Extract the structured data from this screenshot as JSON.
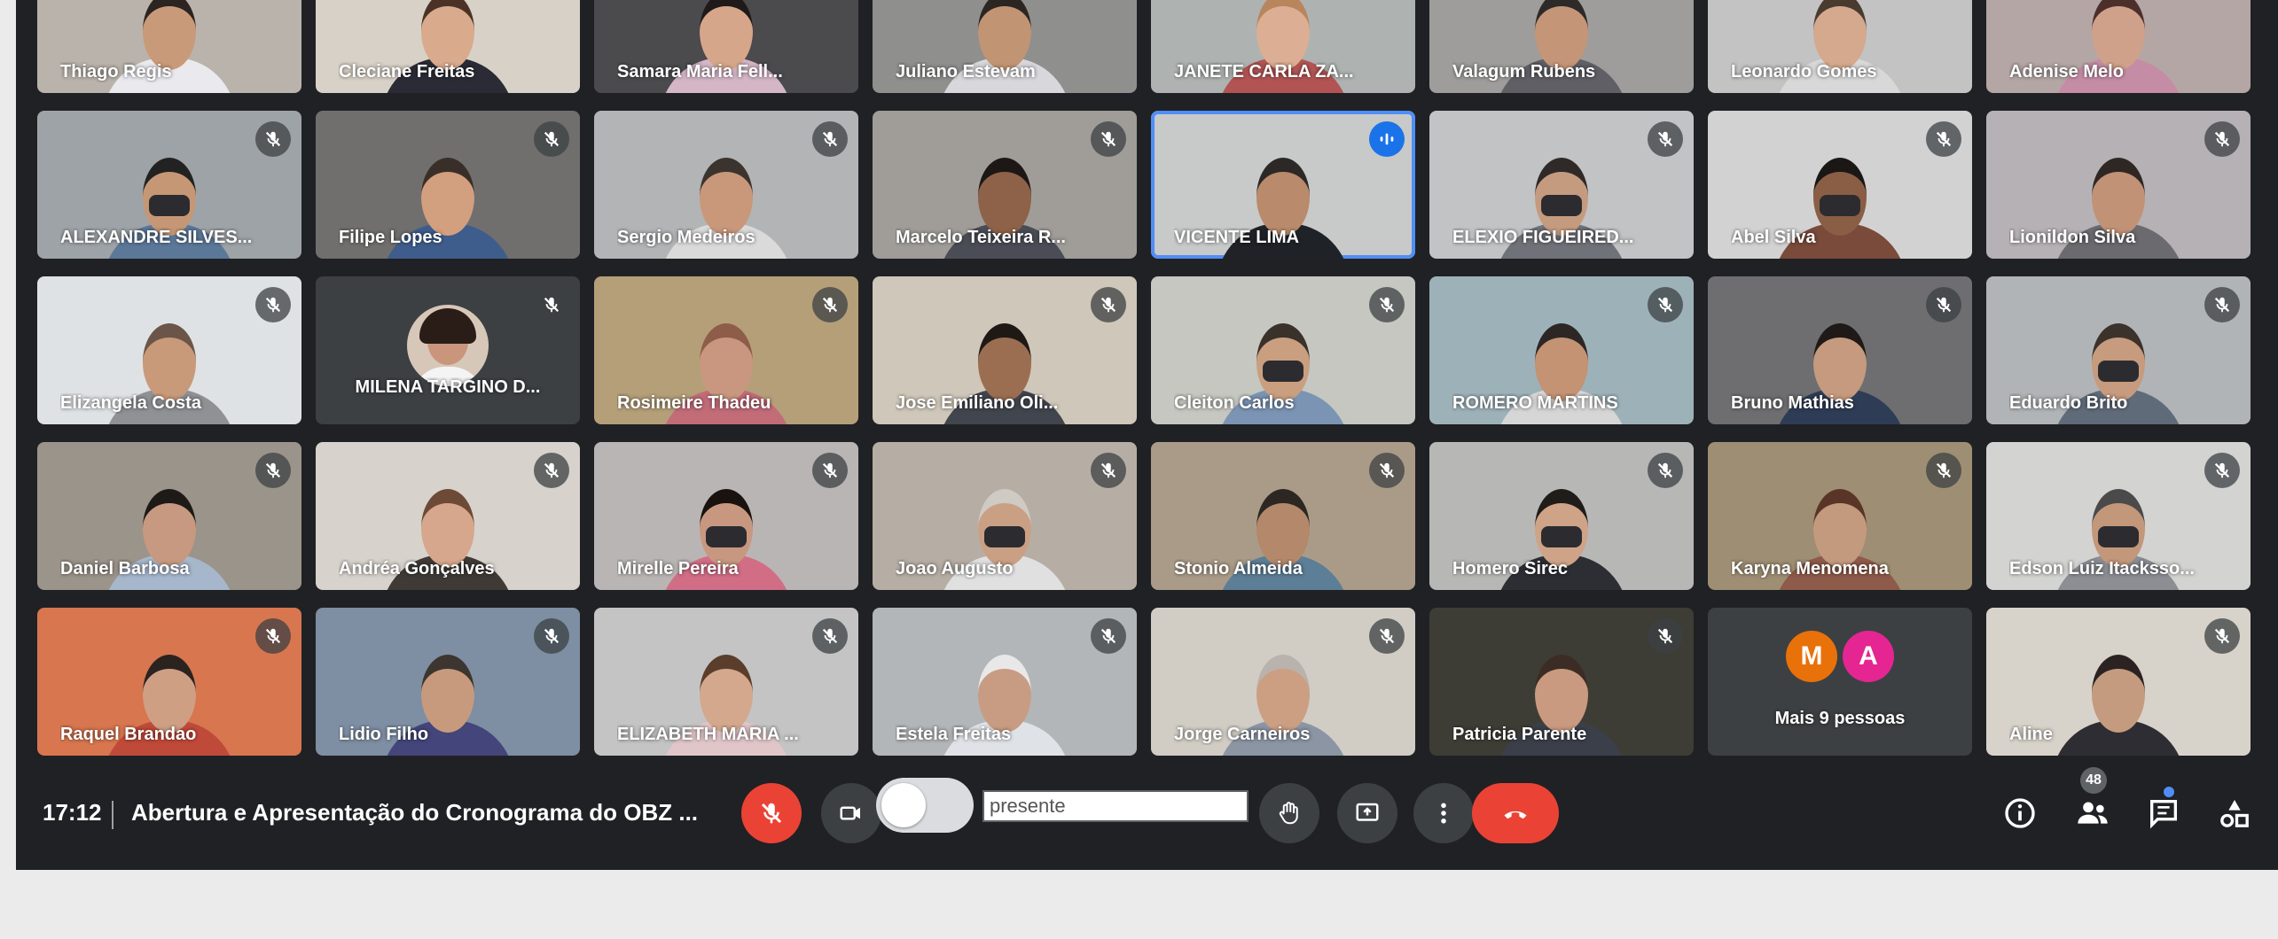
{
  "tiles": [
    {
      "name": "Thiago Regis",
      "bg": "#b9b3ab",
      "skin": "#c99a7a",
      "hair": "#2b2420",
      "shirt": "#e9e9ee",
      "mic": "muted"
    },
    {
      "name": "Cleciane Freitas",
      "bg": "#d8d1c7",
      "skin": "#d9aa8c",
      "hair": "#4a3326",
      "shirt": "#2b2b35",
      "mic": "muted"
    },
    {
      "name": "Samara Maria Fell...",
      "bg": "#4b4a4d",
      "skin": "#d6a68a",
      "hair": "#1f1a19",
      "shirt": "#d4b6c6",
      "mic": "muted"
    },
    {
      "name": "Juliano Estevam",
      "bg": "#8f8f8e",
      "skin": "#c19473",
      "hair": "#2c2622",
      "shirt": "#d8d8dc",
      "mic": "muted"
    },
    {
      "name": "JANETE CARLA ZA...",
      "bg": "#aeb3b2",
      "skin": "#dcae93",
      "hair": "#b8855d",
      "shirt": "#b25454",
      "mic": "muted"
    },
    {
      "name": "Valagum Rubens",
      "bg": "#9e9d9c",
      "skin": "#c49577",
      "hair": "#2d2a28",
      "shirt": "#5f5f65",
      "mic": "muted"
    },
    {
      "name": "Leonardo Gomes",
      "bg": "#c2c3c2",
      "skin": "#d4a98d",
      "hair": "#4a3b31",
      "shirt": "#d8d8d8",
      "mic": "muted"
    },
    {
      "name": "Adenise Melo",
      "bg": "#b4a6a5",
      "skin": "#cfa18a",
      "hair": "#4c2f2b",
      "shirt": "#c58ca5",
      "mic": "muted"
    },
    {
      "name": "ALEXANDRE SILVES...",
      "bg": "#9ea3a8",
      "skin": "#c59775",
      "hair": "#222",
      "shirt": "#5c7899",
      "mic": "muted",
      "mask": true
    },
    {
      "name": "Filipe Lopes",
      "bg": "#706f6e",
      "skin": "#d29f7f",
      "hair": "#3a2f28",
      "shirt": "#3f5d8c",
      "mic": "muted"
    },
    {
      "name": "Sergio Medeiros",
      "bg": "#b2b4b5",
      "skin": "#c9977a",
      "hair": "#3b342e",
      "shirt": "#dadada",
      "mic": "muted"
    },
    {
      "name": "Marcelo Teixeira R...",
      "bg": "#a09d99",
      "skin": "#8d6248",
      "hair": "#1d1816",
      "shirt": "#4a4d55",
      "mic": "muted"
    },
    {
      "name": "VICENTE LIMA",
      "bg": "#c8c9c9",
      "skin": "#b98a6b",
      "hair": "#2b2826",
      "shirt": "#1f2327",
      "mic": "active"
    },
    {
      "name": "ELEXIO FIGUEIRED...",
      "bg": "#c1c3c4",
      "skin": "#c59b80",
      "hair": "#2f2a28",
      "shirt": "#6f7278",
      "mic": "muted",
      "mask": true
    },
    {
      "name": "Abel Silva",
      "bg": "#d2d2d2",
      "skin": "#8a5e45",
      "hair": "#1b1715",
      "shirt": "#7a4a3a",
      "mic": "muted",
      "mask": true
    },
    {
      "name": "Lionildon Silva",
      "bg": "#b6b1b5",
      "skin": "#c19276",
      "hair": "#2e2724",
      "shirt": "#6a6a6f",
      "mic": "muted"
    },
    {
      "name": "Elizangela Costa",
      "bg": "#dfe2e4",
      "skin": "#c89a7a",
      "hair": "#6b5549",
      "shirt": "#8f9195",
      "mic": "muted"
    },
    {
      "name": "MILENA TARGINO D...",
      "avatar": true,
      "bg": "#3c4043",
      "mic": "muted"
    },
    {
      "name": "Rosimeire Thadeu",
      "bg": "#b59f79",
      "skin": "#c9977f",
      "hair": "#8e5d4a",
      "shirt": "#c26c78",
      "mic": "muted"
    },
    {
      "name": "Jose Emiliano Oli...",
      "bg": "#cfc7b9",
      "skin": "#9b6e52",
      "hair": "#1e1915",
      "shirt": "#41454d",
      "mic": "muted"
    },
    {
      "name": "Cleiton Carlos",
      "bg": "#c5c7c0",
      "skin": "#c99f80",
      "hair": "#3a312a",
      "shirt": "#7b94b3",
      "mic": "muted",
      "mask": true
    },
    {
      "name": "ROMERO MARTINS",
      "bg": "#9db2b8",
      "skin": "#c39374",
      "hair": "#2c2725",
      "shirt": "#d6d6d6",
      "mic": "muted"
    },
    {
      "name": "Bruno Mathias",
      "bg": "#6e6e70",
      "skin": "#c59a7e",
      "hair": "#1f1a17",
      "shirt": "#2f3c56",
      "mic": "muted"
    },
    {
      "name": "Eduardo Brito",
      "bg": "#b1b4b6",
      "skin": "#c69b7e",
      "hair": "#3b322c",
      "shirt": "#606b7a",
      "mic": "muted",
      "mask": true
    },
    {
      "name": "Daniel Barbosa",
      "bg": "#9b948a",
      "skin": "#c69980",
      "hair": "#1d1a18",
      "shirt": "#a6b7cc",
      "mic": "muted"
    },
    {
      "name": "Andréa Gonçalves",
      "bg": "#d7d2cc",
      "skin": "#d6a78c",
      "hair": "#6d4a35",
      "shirt": "#3f3a36",
      "mic": "muted"
    },
    {
      "name": "Mirelle Pereira",
      "bg": "#b9b5b4",
      "skin": "#c7987f",
      "hair": "#19120f",
      "shirt": "#d16e86",
      "mic": "muted",
      "mask": true
    },
    {
      "name": "Joao Augusto",
      "bg": "#b6aea4",
      "skin": "#caa085",
      "hair": "#cfcac3",
      "shirt": "#e0e0e0",
      "mic": "muted",
      "mask": true
    },
    {
      "name": "Stonio Almeida",
      "bg": "#aa9b88",
      "skin": "#b3886b",
      "hair": "#2c2723",
      "shirt": "#5c7e96",
      "mic": "muted"
    },
    {
      "name": "Homero Sirec",
      "bg": "#b7b7b6",
      "skin": "#cfa387",
      "hair": "#201c19",
      "shirt": "#2c2e34",
      "mic": "muted",
      "mask": true
    },
    {
      "name": "Karyna Menomena",
      "bg": "#9e8e73",
      "skin": "#c49a7f",
      "hair": "#5a3527",
      "shirt": "#8e5a49",
      "mic": "muted"
    },
    {
      "name": "Edson Luiz Itacksso...",
      "bg": "#d3d3d1",
      "skin": "#c3977a",
      "hair": "#4a4a4a",
      "shirt": "#8b8e93",
      "mic": "muted",
      "mask": true
    },
    {
      "name": "Raquel Brandao",
      "bg": "#d8764f",
      "skin": "#cf9f84",
      "hair": "#2a2320",
      "shirt": "#c04a3a",
      "mic": "muted"
    },
    {
      "name": "Lidio Filho",
      "bg": "#7e8ea3",
      "skin": "#c79a7d",
      "hair": "#3c3530",
      "shirt": "#44457a",
      "mic": "muted"
    },
    {
      "name": "ELIZABETH MARIA ...",
      "bg": "#c4c4c4",
      "skin": "#d3a88d",
      "hair": "#5b3d2c",
      "shirt": "#e0c6c9",
      "mic": "muted"
    },
    {
      "name": "Estela Freitas",
      "bg": "#b3b6b8",
      "skin": "#c89c82",
      "hair": "#e8e8e8",
      "shirt": "#dfe3e7",
      "mic": "muted"
    },
    {
      "name": "Jorge Carneiros",
      "bg": "#d1cdc5",
      "skin": "#cc9f83",
      "hair": "#b9b2ad",
      "shirt": "#8c95a4",
      "mic": "muted"
    },
    {
      "name": "Patricia Parente",
      "bg": "#3e3d35",
      "skin": "#c99a7f",
      "hair": "#3b2c25",
      "shirt": "#3b3f49",
      "mic": "muted"
    },
    {
      "name": "Mais 9 pessoas",
      "more": true,
      "bg": "#3c4043",
      "letters": [
        {
          "l": "M",
          "c": "#e8710a"
        },
        {
          "l": "A",
          "c": "#e52592"
        }
      ]
    },
    {
      "name": "Aline",
      "bg": "#d8d3ca",
      "skin": "#c49b7f",
      "hair": "#2a2321",
      "shirt": "#2d2d33",
      "mic": "muted"
    }
  ],
  "controls": {
    "time": "17:12",
    "meeting_title": "Abertura e Apresentação do Cronograma do OBZ ...",
    "chat_text": "presente",
    "participants_count": "48"
  },
  "icons": {
    "mic_off": "mic-off-icon",
    "camera": "camera-icon",
    "raise_hand": "raise-hand-icon",
    "present": "present-screen-icon",
    "more": "more-options-icon",
    "hangup": "hang-up-icon",
    "info": "info-icon",
    "people": "people-icon",
    "chat": "chat-icon",
    "activities": "activities-icon"
  }
}
